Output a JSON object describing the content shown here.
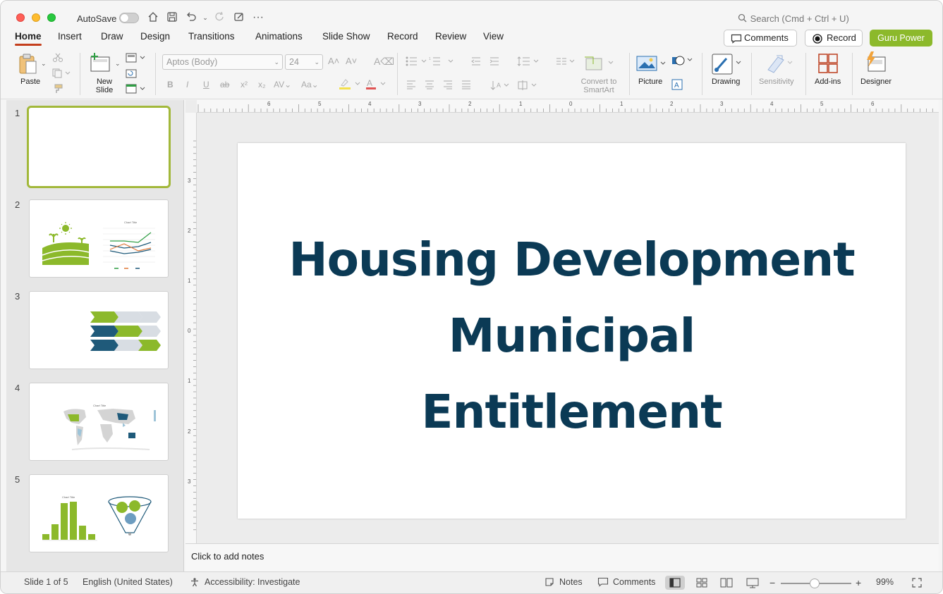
{
  "titlebar": {
    "autosave_label": "AutoSave",
    "search_placeholder": "Search (Cmd + Ctrl + U)"
  },
  "tabs": [
    "Home",
    "Insert",
    "Draw",
    "Design",
    "Transitions",
    "Animations",
    "Slide Show",
    "Record",
    "Review",
    "View"
  ],
  "active_tab": "Home",
  "header_buttons": {
    "comments": "Comments",
    "record": "Record",
    "guru": "Guru Power",
    "guru_color": "#8cb92b"
  },
  "ribbon": {
    "paste": "Paste",
    "new_slide": "New Slide",
    "font_name": "Aptos (Body)",
    "font_size": "24",
    "convert_smartart": "Convert to SmartArt",
    "picture": "Picture",
    "drawing": "Drawing",
    "sensitivity": "Sensitivity",
    "addins": "Add-ins",
    "designer": "Designer"
  },
  "thumbnails": [
    {
      "number": "1",
      "content": "blank",
      "selected": true
    },
    {
      "number": "2",
      "content": "farm-line-chart",
      "chart_title": "Chart Title"
    },
    {
      "number": "3",
      "content": "chevron-process"
    },
    {
      "number": "4",
      "content": "world-map",
      "chart_title": "Chart Title"
    },
    {
      "number": "5",
      "content": "histogram-funnel",
      "chart_title": "Chart Title"
    }
  ],
  "ruler_h_labels": [
    "6",
    "5",
    "4",
    "3",
    "2",
    "1",
    "0",
    "1",
    "2",
    "3",
    "4",
    "5",
    "6"
  ],
  "ruler_v_labels": [
    "3",
    "2",
    "1",
    "0",
    "1",
    "2",
    "3"
  ],
  "slide": {
    "title_lines": [
      "Housing Development",
      "Municipal",
      "Entitlement"
    ],
    "title_color": "#0b3a55"
  },
  "notes": {
    "placeholder": "Click to add notes"
  },
  "statusbar": {
    "slide_info": "Slide 1 of 5",
    "language": "English (United States)",
    "accessibility": "Accessibility: Investigate",
    "notes": "Notes",
    "comments": "Comments",
    "zoom": "99%"
  },
  "colors": {
    "accent_green": "#a2b83a",
    "dark_blue": "#1f5a7a",
    "tab_underline": "#c43e1c"
  }
}
